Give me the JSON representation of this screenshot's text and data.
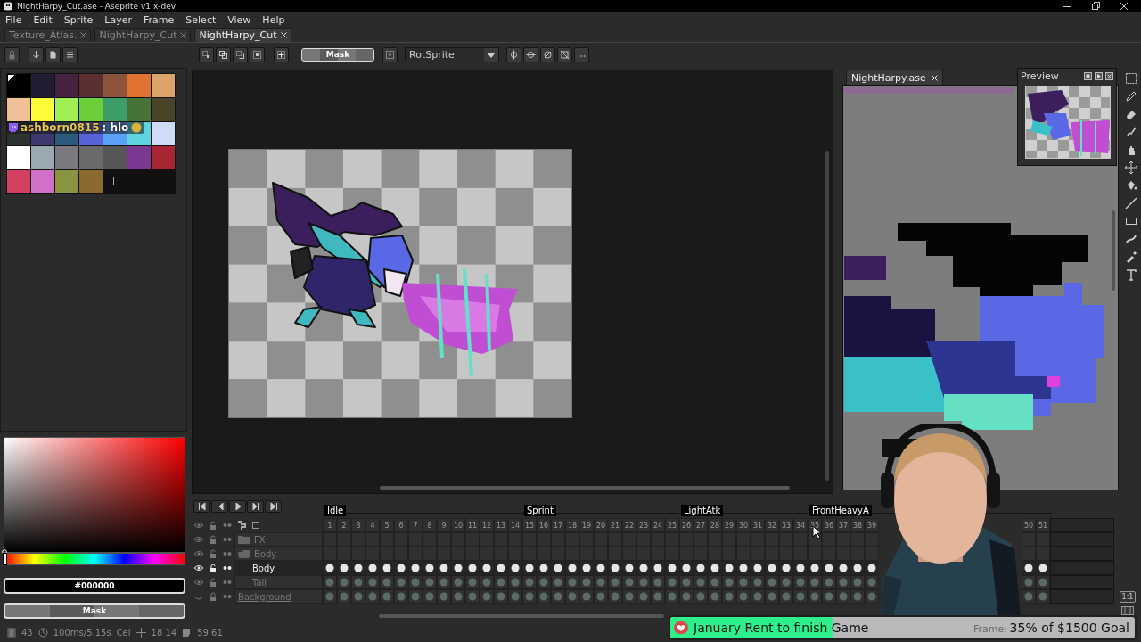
{
  "window": {
    "title": "NightHarpy_Cut.ase - Aseprite v1.x-dev"
  },
  "menu": [
    "File",
    "Edit",
    "Sprite",
    "Layer",
    "Frame",
    "Select",
    "View",
    "Help"
  ],
  "tabs": [
    {
      "label": "Texture_Atlas.",
      "selected": false
    },
    {
      "label": "NightHarpy_Cut",
      "selected": false
    },
    {
      "label": "NightHarpy_Cut",
      "selected": true
    }
  ],
  "toolbar": {
    "mask_button": "Mask",
    "rotation_algorithm": "RotSprite"
  },
  "palette": {
    "swatches": [
      {
        "color": "#000000",
        "selected": true
      },
      {
        "color": "#1f1e33",
        "selected": false
      },
      {
        "color": "#45233f",
        "selected": false
      },
      {
        "color": "#5c2f30",
        "selected": false
      },
      {
        "color": "#8c553b",
        "selected": false
      },
      {
        "color": "#e0722f",
        "selected": false
      },
      {
        "color": "#dea26b",
        "selected": false
      },
      {
        "color": "#f0c098",
        "selected": false
      },
      {
        "color": "#fbfb3a",
        "selected": false
      },
      {
        "color": "#a2ee55",
        "selected": false
      },
      {
        "color": "#6ccf3a",
        "selected": false
      },
      {
        "color": "#3d9e6a",
        "selected": false
      },
      {
        "color": "#477336",
        "selected": false
      },
      {
        "color": "#4a4426",
        "selected": false
      },
      {
        "color": "#2d3330",
        "selected": false
      },
      {
        "color": "#3f3a6e",
        "selected": false
      },
      {
        "color": "#2c5a7a",
        "selected": false
      },
      {
        "color": "#5a62d8",
        "selected": false
      },
      {
        "color": "#5ba0f5",
        "selected": false
      },
      {
        "color": "#5fd2e0",
        "selected": false
      },
      {
        "color": "#cfdcf5",
        "selected": false
      },
      {
        "color": "#ffffff",
        "selected": false
      },
      {
        "color": "#9aa8b0",
        "selected": false
      },
      {
        "color": "#7a7a80",
        "selected": false
      },
      {
        "color": "#6a6a6a",
        "selected": false
      },
      {
        "color": "#565656",
        "selected": false
      },
      {
        "color": "#7a3890",
        "selected": false
      },
      {
        "color": "#a82634",
        "selected": false
      },
      {
        "color": "#d44060",
        "selected": false
      },
      {
        "color": "#d070c8",
        "selected": false
      },
      {
        "color": "#8a9440",
        "selected": false
      },
      {
        "color": "#8a6a30",
        "selected": false
      }
    ]
  },
  "color": {
    "hex": "#000000",
    "mask": "Mask",
    "hue": {
      "level": 0
    }
  },
  "side_editor": {
    "tab": "NightHarpy.ase",
    "preview_title": "Preview"
  },
  "timeline": {
    "tags": [
      {
        "name": "Idle",
        "frames": [
          "1",
          "2",
          "3",
          "4",
          "5",
          "6",
          "7",
          "8",
          "9",
          "10",
          "11",
          "12",
          "13",
          "14"
        ]
      },
      {
        "name": "Sprint",
        "frames": [
          "15",
          "16",
          "17",
          "18",
          "19",
          "20",
          "21",
          "22",
          "23",
          "24",
          "25"
        ]
      },
      {
        "name": "LightAtk",
        "frames": [
          "26",
          "27",
          "28",
          "29",
          "30",
          "31",
          "32",
          "33",
          "34"
        ]
      },
      {
        "name": "FrontHeavyA",
        "frames": [
          "35",
          "36",
          "37",
          "38",
          "39"
        ],
        "frames_after_cover": [
          "50",
          "51"
        ]
      }
    ],
    "layers": [
      {
        "name": "FX",
        "kind": "group",
        "expanded": false,
        "visible": true,
        "locked": false,
        "active": false,
        "has_cels": false
      },
      {
        "name": "Body",
        "kind": "group",
        "expanded": true,
        "visible": true,
        "locked": false,
        "active": false,
        "has_cels": false,
        "children": [
          {
            "name": "Body",
            "kind": "layer",
            "visible": true,
            "locked": false,
            "active": true,
            "has_cels": true
          },
          {
            "name": "Tail",
            "kind": "layer",
            "visible": true,
            "locked": false,
            "active": false,
            "has_cels": true
          }
        ]
      },
      {
        "name": "Background",
        "kind": "background",
        "visible": false,
        "locked": true,
        "active": false,
        "has_cels": true
      }
    ],
    "zoom_button": "1:1"
  },
  "status_bar": {
    "frame": "43",
    "duration": "100ms/5.15s",
    "mode": "Cel",
    "position": "18 14",
    "size": "59 61",
    "frame_label": "Frame:"
  },
  "chat": {
    "user": "ashborn0815",
    "message": ": hlo"
  },
  "goal": {
    "title": "January Rent to finish Game",
    "progress": "35% of $1500 Goal",
    "level": 0.35
  }
}
